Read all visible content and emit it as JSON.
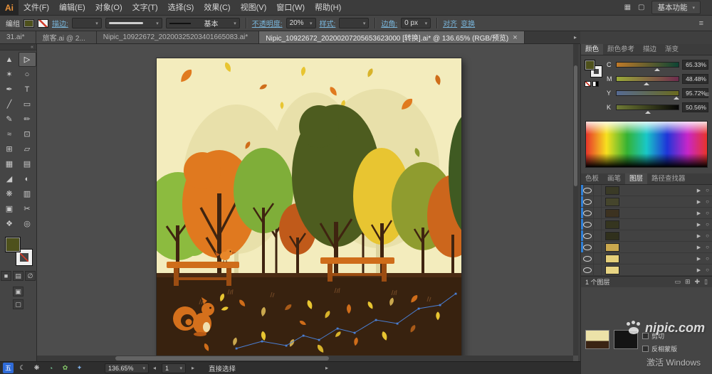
{
  "icons": {
    "chevron_down": "▾",
    "chevron_right": "▸",
    "scroll_left": "◂",
    "scroll_right": "▸",
    "menu": "≡",
    "double_left": "«",
    "expand": "▶",
    "target": "○",
    "arrange": "▦",
    "screen": "▢",
    "close": "×"
  },
  "menubar": {
    "logo": "Ai",
    "items": [
      "文件(F)",
      "编辑(E)",
      "对象(O)",
      "文字(T)",
      "选择(S)",
      "效果(C)",
      "视图(V)",
      "窗口(W)",
      "帮助(H)"
    ],
    "workspace": "基本功能"
  },
  "controlbar": {
    "selection": "编组",
    "stroke": "描边:",
    "brush": "基本",
    "opacity": "不透明度:",
    "opacity_value": "20%",
    "style": "样式:",
    "corner": "边角:",
    "corner_value": "0 px",
    "align": "对齐",
    "transform": "变换"
  },
  "tabs": [
    {
      "label": "31.ai*",
      "active": false
    },
    {
      "label": "旅客.ai @ 2...",
      "active": false
    },
    {
      "label": "Nipic_10922672_20200325203401665083.ai*",
      "active": false
    },
    {
      "label": "Nipic_10922672_20200207205653623000 [转换].ai* @ 136.65% (RGB/预览)",
      "active": true,
      "close": "×"
    }
  ],
  "tools": [
    {
      "name": "selection-tool",
      "glyph": "▲"
    },
    {
      "name": "direct-selection-tool",
      "glyph": "▷",
      "active": true
    },
    {
      "name": "magic-wand-tool",
      "glyph": "✶"
    },
    {
      "name": "lasso-tool",
      "glyph": "○"
    },
    {
      "name": "pen-tool",
      "glyph": "✒"
    },
    {
      "name": "type-tool",
      "glyph": "T"
    },
    {
      "name": "line-segment-tool",
      "glyph": "╱"
    },
    {
      "name": "rectangle-tool",
      "glyph": "▭"
    },
    {
      "name": "paintbrush-tool",
      "glyph": "✎"
    },
    {
      "name": "pencil-tool",
      "glyph": "✏"
    },
    {
      "name": "width-tool",
      "glyph": "≈"
    },
    {
      "name": "free-transform-tool",
      "glyph": "⊡"
    },
    {
      "name": "shape-builder-tool",
      "glyph": "⊞"
    },
    {
      "name": "perspective-grid-tool",
      "glyph": "▱"
    },
    {
      "name": "mesh-tool",
      "glyph": "▦"
    },
    {
      "name": "gradient-tool",
      "glyph": "▤"
    },
    {
      "name": "eyedropper-tool",
      "glyph": "◢"
    },
    {
      "name": "blend-tool",
      "glyph": "◐"
    },
    {
      "name": "symbol-sprayer-tool",
      "glyph": "❋"
    },
    {
      "name": "graph-tool",
      "glyph": "▥"
    },
    {
      "name": "artboard-tool",
      "glyph": "▣"
    },
    {
      "name": "slice-tool",
      "glyph": "✂"
    },
    {
      "name": "hand-tool",
      "glyph": "❖"
    },
    {
      "name": "zoom-tool",
      "glyph": "◎"
    }
  ],
  "toolbar_modes": [
    {
      "name": "color-fill-mode-icon",
      "glyph": "■"
    },
    {
      "name": "gradient-fill-mode-icon",
      "glyph": "▤"
    },
    {
      "name": "none-fill-mode-icon",
      "glyph": "∅"
    }
  ],
  "toolbar_bottom": [
    {
      "name": "drawing-mode-icon",
      "glyph": "▣"
    },
    {
      "name": "screen-mode-icon",
      "glyph": "▢"
    }
  ],
  "color_panel": {
    "tabs": [
      {
        "label": "颜色",
        "active": true
      },
      {
        "label": "颜色参考",
        "active": false
      },
      {
        "label": "描边",
        "active": false
      },
      {
        "label": "渐变",
        "active": false
      }
    ],
    "channels": [
      {
        "label": "C",
        "value": "65.33%",
        "g1": "#c07a28",
        "g2": "#0c4434",
        "pos": "65%"
      },
      {
        "label": "M",
        "value": "48.48%",
        "g1": "#9aaa38",
        "g2": "#6e2c4e",
        "pos": "48%"
      },
      {
        "label": "Y",
        "value": "95.72%",
        "g1": "#566a92",
        "g2": "#6a6a1e",
        "pos": "96%"
      },
      {
        "label": "K",
        "value": "50.56%",
        "g1": "#6f7a35",
        "g2": "#060606",
        "pos": "50%"
      }
    ],
    "fill_color": "#4e511c"
  },
  "layers": {
    "tabs": [
      {
        "label": "色板",
        "active": false
      },
      {
        "label": "画笔",
        "active": false
      },
      {
        "label": "图层",
        "active": true
      },
      {
        "label": "路径查找器",
        "active": false
      }
    ],
    "rows": [
      {
        "selected": true,
        "thumb": "#3a3a26"
      },
      {
        "selected": true,
        "thumb": "#45452c"
      },
      {
        "selected": true,
        "thumb": "#3c3220"
      },
      {
        "selected": true,
        "thumb": "#35351f"
      },
      {
        "selected": true,
        "thumb": "#30301c"
      },
      {
        "selected": true,
        "thumb": "#caa84e"
      },
      {
        "selected": false,
        "thumb": "#e4cf7a"
      },
      {
        "selected": false,
        "thumb": "#e8d584"
      }
    ],
    "footer": "1 个图层",
    "footer_icons": [
      {
        "name": "make-mask-icon",
        "glyph": "▭"
      },
      {
        "name": "new-sublayer-icon",
        "glyph": "⊞"
      },
      {
        "name": "new-layer-icon",
        "glyph": "✚"
      },
      {
        "name": "delete-layer-icon",
        "glyph": "▯"
      }
    ]
  },
  "transparency": {
    "clip": "剪切",
    "invert": "反相蒙版"
  },
  "statusbar": {
    "zoom": "136.65%",
    "artboard": "1",
    "tool": "直接选择"
  },
  "taskbar": {
    "icons": [
      {
        "name": "start-five-icon",
        "glyph": "五",
        "bg": "#2f6bd8",
        "color": "#ffffff"
      },
      {
        "name": "moon-icon",
        "glyph": "☾",
        "bg": "",
        "color": "#e8e8e8"
      },
      {
        "name": "paw-icon",
        "glyph": "❋",
        "bg": "",
        "color": "#e0e0e0"
      },
      {
        "name": "browser-circle-icon",
        "glyph": "◔",
        "bg": "",
        "color": "#7fd4a0"
      },
      {
        "name": "leaf-icon",
        "glyph": "✿",
        "bg": "",
        "color": "#86c96a"
      },
      {
        "name": "wrench-icon",
        "glyph": "✦",
        "bg": "",
        "color": "#7fb0e8"
      }
    ]
  },
  "watermark": {
    "text": "nipic.com"
  },
  "activate": {
    "text": "激活 Windows"
  }
}
